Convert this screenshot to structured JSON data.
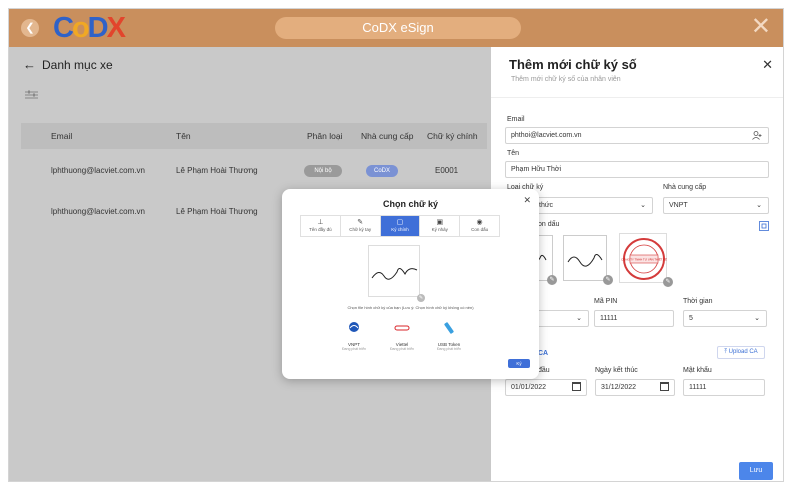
{
  "app": {
    "title": "CoDX eSign",
    "logo_letters": [
      "C",
      "o",
      "D",
      "X"
    ]
  },
  "breadcrumb": {
    "label": "Danh mục xe"
  },
  "table": {
    "headers": [
      "Email",
      "Tên",
      "Phân loại",
      "Nhà cung cấp",
      "Chữ ký chính"
    ],
    "rows": [
      {
        "email": "lphthuong@lacviet.com.vn",
        "name": "Lê Phạm Hoài Thương",
        "type": "Nội bộ",
        "provider": "CoDX",
        "main": "E0001"
      },
      {
        "email": "lphthuong@lacviet.com.vn",
        "name": "Lê Phạm Hoài Thương",
        "type": "",
        "provider": "",
        "main": ""
      }
    ]
  },
  "panel": {
    "title": "Thêm mới chữ ký số",
    "subtitle": "Thêm mới chữ ký số của nhân viên",
    "email_label": "Email",
    "email_value": "phthoi@lacviet.com.vn",
    "name_label": "Tên",
    "name_value": "Phạm Hữu Thời",
    "type_label": "Loại chữ ký",
    "type_value": "thức",
    "provider_label": "Nhà cung cấp",
    "provider_value": "VNPT",
    "signature_label": "on dấu",
    "stamp_text": "CÔNG TY TNHH TƯ VẤN THIẾT KẾ",
    "pin_label": "Mã PIN",
    "pin_value": "11111",
    "time_label": "Thời gian",
    "time_value": "5",
    "ca_label": "CA",
    "upload_label": "Upload CA",
    "start_label": "đầu",
    "start_value": "01/01/2022",
    "end_label": "Ngày kết thúc",
    "end_value": "31/12/2022",
    "password_label": "Mật khẩu",
    "password_value": "11111",
    "save_label": "Lưu"
  },
  "modal": {
    "title": "Chọn chữ ký",
    "tabs": [
      {
        "label": "Tên đầy đủ",
        "icon": "⊥"
      },
      {
        "label": "Chữ ký tay",
        "icon": "✎"
      },
      {
        "label": "Ký chính",
        "icon": "▢"
      },
      {
        "label": "Ký nháy",
        "icon": "▣"
      },
      {
        "label": "Con dấu",
        "icon": "◉"
      }
    ],
    "hint": "Chọn file hình chữ ký của bạn (Lưu ý: Chọn hình chữ ký không có nền)",
    "providers": [
      {
        "name": "VNPT",
        "desc": "Đang phát triển",
        "color": "#1e56b8"
      },
      {
        "name": "Viettel",
        "desc": "Đang phát triển",
        "color": "#d9252a"
      },
      {
        "name": "USB Token",
        "desc": "Đang phát triển",
        "color": "#3aa0e0"
      }
    ],
    "sign_label": "Ký"
  },
  "colors": {
    "topbar": "#c98f5d",
    "accent": "#3f6fd8",
    "save": "#4c86ea"
  }
}
